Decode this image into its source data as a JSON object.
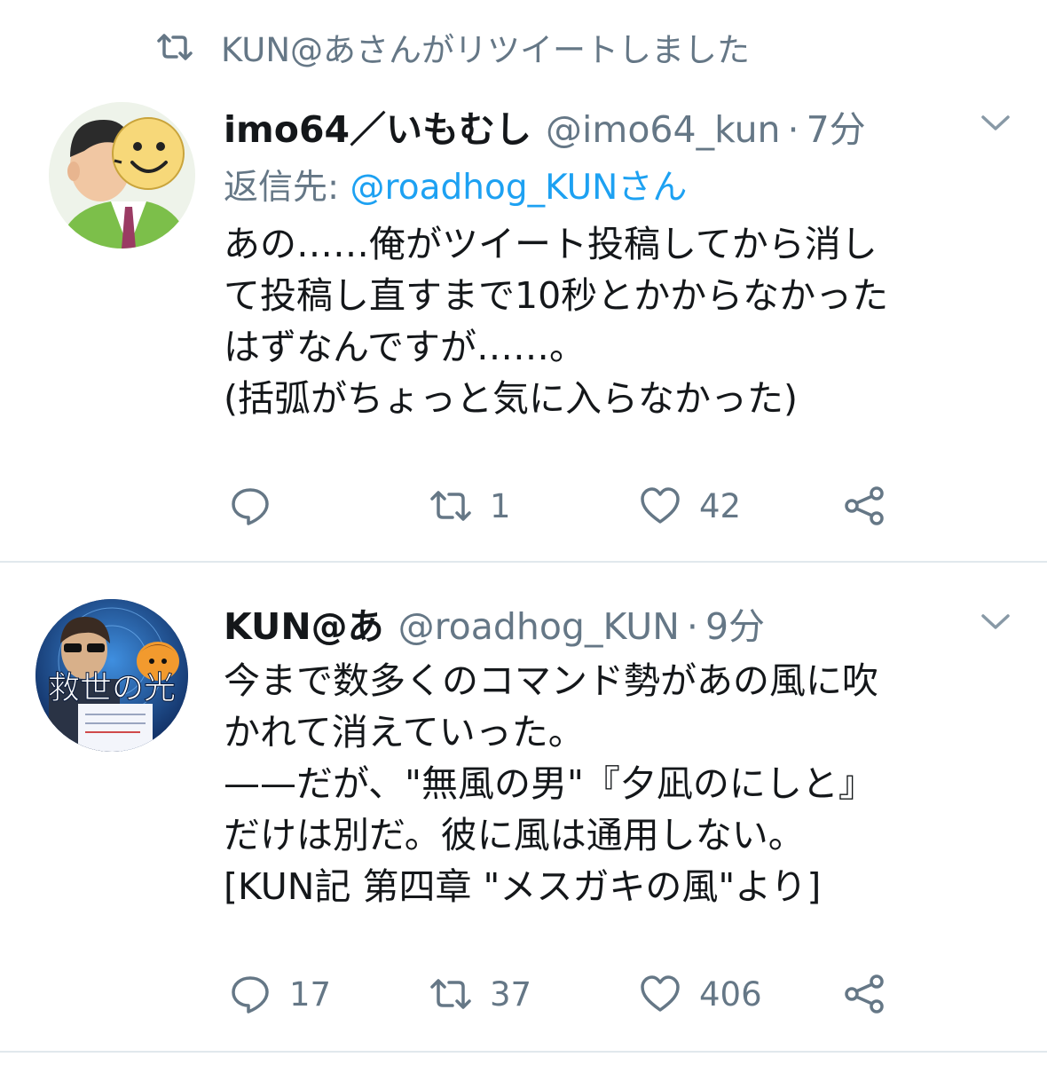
{
  "retweet_banner": {
    "icon": "retweet-icon",
    "text": "KUN@あさんがリツイートしました"
  },
  "tweets": [
    {
      "display_name": "imo64／いもむし",
      "handle": "@imo64_kun",
      "separator": "·",
      "time": "7分",
      "reply_prefix": "返信先:",
      "reply_handle": "@roadhog_KUNさん",
      "text_lines": [
        "あの……俺がツイート投稿してから消し",
        "て投稿し直すまで10秒とかからなかった",
        "はずなんですが……。",
        "(括弧がちょっと気に入らなかった)"
      ],
      "actions": {
        "reply_count": "",
        "retweet_count": "1",
        "like_count": "42"
      }
    },
    {
      "display_name": "KUN@あ",
      "handle": "@roadhog_KUN",
      "separator": "·",
      "time": "9分",
      "avatar_text": "救世の光",
      "text_lines": [
        "今まで数多くのコマンド勢があの風に吹",
        "かれて消えていった。",
        "——だが、\"無風の男\"『夕凪のにしと』",
        "だけは別だ。彼に風は通用しない。",
        "[KUN記 第四章 \"メスガキの風\"より]"
      ],
      "actions": {
        "reply_count": "17",
        "retweet_count": "37",
        "like_count": "406"
      }
    }
  ],
  "colors": {
    "text": "#14171a",
    "secondary": "#657786",
    "link": "#1da1f2",
    "divider": "#e1e8ed"
  }
}
